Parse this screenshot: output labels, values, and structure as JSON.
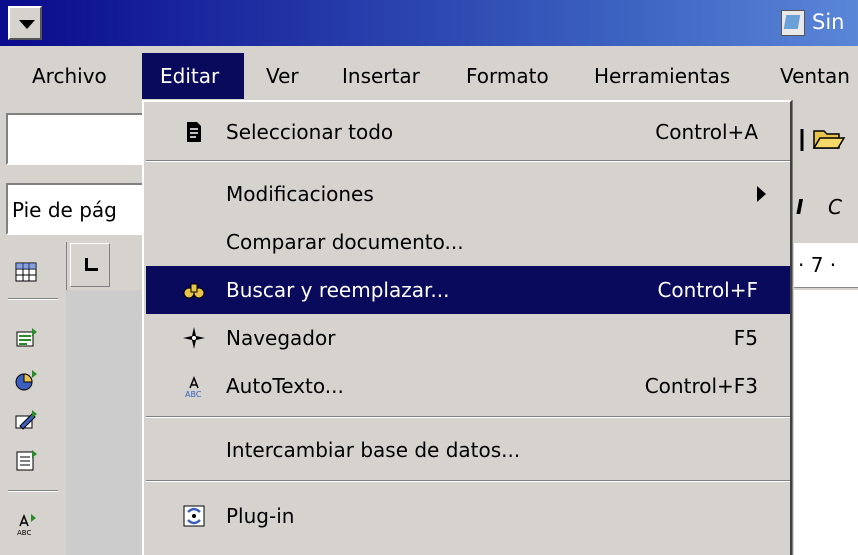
{
  "title": "Sin",
  "menubar": {
    "items": [
      {
        "label": "Archivo"
      },
      {
        "label": "Editar"
      },
      {
        "label": "Ver"
      },
      {
        "label": "Insertar"
      },
      {
        "label": "Formato"
      },
      {
        "label": "Herramientas"
      },
      {
        "label": "Ventan"
      }
    ]
  },
  "toolbar": {
    "paragraph_style": "Pie de pág",
    "format_labels": [
      "I",
      "C"
    ]
  },
  "ruler": {
    "text": "· 7 ·"
  },
  "edit_menu": {
    "select_all": {
      "label": "Seleccionar todo",
      "shortcut": "Control+A"
    },
    "changes": {
      "label": "Modificaciones"
    },
    "compare": {
      "label": "Comparar documento..."
    },
    "find_replace": {
      "label": "Buscar y reemplazar...",
      "shortcut": "Control+F"
    },
    "navigator": {
      "label": "Navegador",
      "shortcut": "F5"
    },
    "autotext": {
      "label": "AutoTexto...",
      "shortcut": "Control+F3"
    },
    "exchange_db": {
      "label": "Intercambiar base de datos..."
    },
    "plugin": {
      "label": "Plug-in"
    }
  },
  "colors": {
    "highlight": "#0a0a5c",
    "title_start": "#0a0a8c",
    "title_end": "#5a86d8",
    "face": "#d6d3ce"
  }
}
